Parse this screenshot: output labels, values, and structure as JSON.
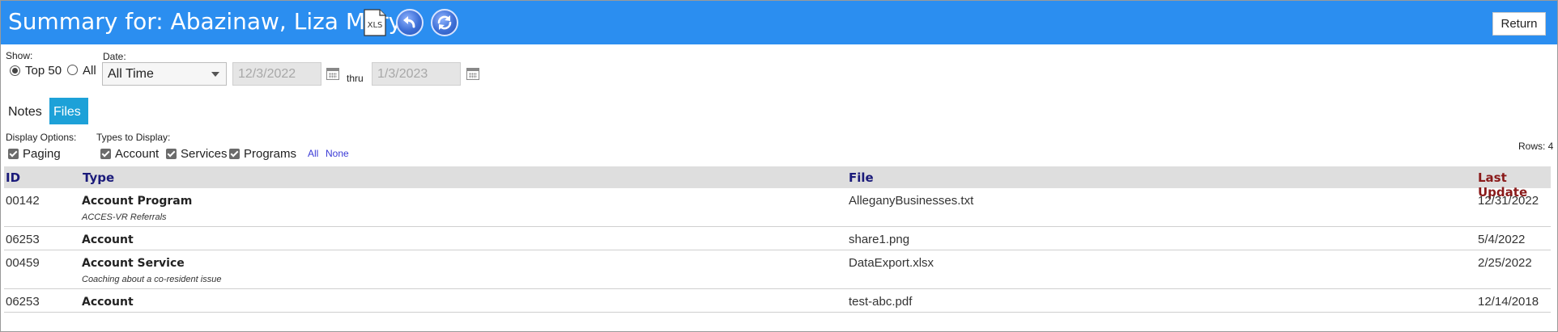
{
  "header": {
    "title": "Summary for: Abazinaw, Liza Mary",
    "xls_label": "XLS",
    "return_label": "Return"
  },
  "filters": {
    "show_label": "Show:",
    "show_options": [
      {
        "label": "Top 50",
        "checked": true
      },
      {
        "label": "All",
        "checked": false
      }
    ],
    "date_label": "Date:",
    "date_selected": "All Time",
    "date_from": "12/3/2022",
    "thru_label": "thru",
    "date_to": "1/3/2023"
  },
  "tabs": [
    {
      "label": "Notes",
      "active": false
    },
    {
      "label": "Files",
      "active": true
    }
  ],
  "options": {
    "display_options_label": "Display Options:",
    "paging_label": "Paging",
    "types_label": "Types to Display:",
    "types": [
      "Account",
      "Services",
      "Programs"
    ],
    "all_link": "All",
    "none_link": "None",
    "rows_label": "Rows: 4"
  },
  "table": {
    "columns": [
      "ID",
      "Type",
      "File",
      "Last Update"
    ],
    "rows": [
      {
        "id": "00142",
        "type": "Account Program",
        "sub": "ACCES-VR Referrals",
        "file": "AlleganyBusinesses.txt",
        "updated": "12/31/2022"
      },
      {
        "id": "06253",
        "type": "Account",
        "sub": "",
        "file": "share1.png",
        "updated": "5/4/2022"
      },
      {
        "id": "00459",
        "type": "Account Service",
        "sub": "Coaching about a co-resident issue",
        "file": "DataExport.xlsx",
        "updated": "2/25/2022"
      },
      {
        "id": "06253",
        "type": "Account",
        "sub": "",
        "file": "test-abc.pdf",
        "updated": "12/14/2018"
      }
    ]
  },
  "colors": {
    "header_bg": "#2b8ef0",
    "active_tab_bg": "#1da1d8",
    "column_header_text": "#1a1a7a",
    "sorted_column_text": "#8a1a1a",
    "link": "#3a3ad6"
  }
}
